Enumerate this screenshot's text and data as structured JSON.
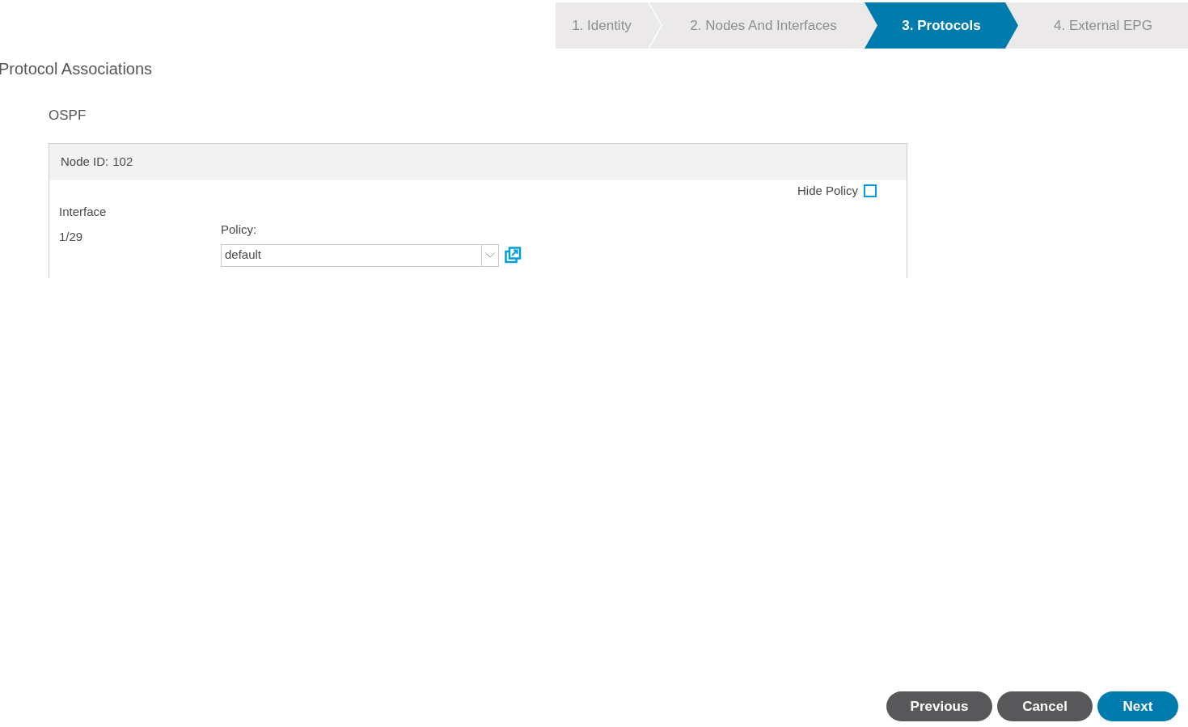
{
  "steps": [
    {
      "label": "1. Identity",
      "selected": false
    },
    {
      "label": "2. Nodes And Interfaces",
      "selected": false
    },
    {
      "label": "3. Protocols",
      "selected": true
    },
    {
      "label": "4. External EPG",
      "selected": false
    }
  ],
  "page_title": "Protocol Associations",
  "section_title": "OSPF",
  "node": {
    "label": "Node ID:",
    "value": "102"
  },
  "hide_policy": {
    "label": "Hide Policy",
    "checked": false
  },
  "interface": {
    "label": "Interface",
    "value": "1/29"
  },
  "policy": {
    "label": "Policy:",
    "value": "default"
  },
  "buttons": [
    {
      "label": "Previous",
      "kind": "secondary"
    },
    {
      "label": "Cancel",
      "kind": "secondary"
    },
    {
      "label": "Next",
      "kind": "primary"
    }
  ]
}
